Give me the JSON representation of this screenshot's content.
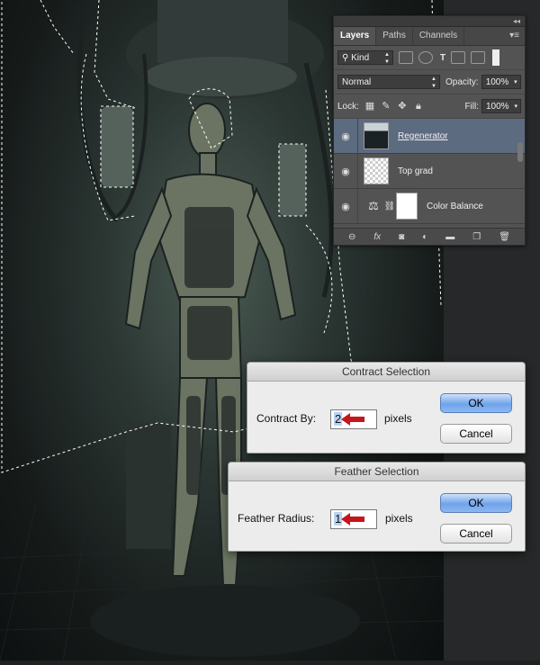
{
  "layers_panel": {
    "tabs": [
      "Layers",
      "Paths",
      "Channels"
    ],
    "collapse_glyph": "◂◂",
    "menu_glyph": "▾≡",
    "filter_kind": "Kind",
    "blend_mode": "Normal",
    "opacity_label": "Opacity:",
    "opacity_value": "100%",
    "lock_label": "Lock:",
    "fill_label": "Fill:",
    "fill_value": "100%",
    "layers": [
      {
        "name": "Regenerator",
        "selected": true
      },
      {
        "name": "Top grad",
        "selected": false
      },
      {
        "name": "Color Balance",
        "selected": false
      }
    ],
    "footer_icons": [
      "link-icon",
      "fx-icon",
      "mask-icon",
      "adjustment-icon",
      "folder-icon",
      "new-layer-icon",
      "trash-icon"
    ],
    "fx_label": "fx"
  },
  "contract_dialog": {
    "title": "Contract Selection",
    "label": "Contract By:",
    "value": "2",
    "unit": "pixels",
    "ok_label": "OK",
    "cancel_label": "Cancel"
  },
  "feather_dialog": {
    "title": "Feather Selection",
    "label": "Feather Radius:",
    "value": "1",
    "unit": "pixels",
    "ok_label": "OK",
    "cancel_label": "Cancel"
  },
  "colors": {
    "selected_layer": "#5d6b80",
    "arrow": "#c4161c",
    "ok_button": "#6fa3ea"
  }
}
